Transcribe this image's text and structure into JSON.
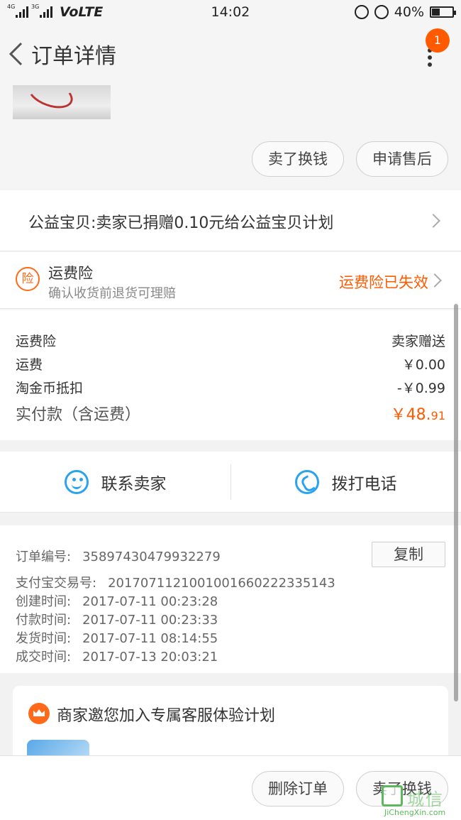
{
  "status_bar": {
    "network_1": "4G",
    "network_2": "3G",
    "volte": "VoLTE",
    "time": "14:02",
    "battery": "40%",
    "battery_level": 0.4
  },
  "nav": {
    "title": "订单详情",
    "badge_count": "1"
  },
  "item_actions": {
    "sell": "卖了换钱",
    "after_sale": "申请售后"
  },
  "charity": {
    "text": "公益宝贝:卖家已捐赠0.10元给公益宝贝计划"
  },
  "insurance": {
    "icon_text": "险",
    "title": "运费险",
    "subtitle": "确认收货前退货可理赔",
    "status": "运费险已失效"
  },
  "fees": {
    "rows": [
      {
        "label": "运费险",
        "value": "卖家赠送"
      },
      {
        "label": "运费",
        "value": "￥0.00"
      },
      {
        "label": "淘金币抵扣",
        "value": "-￥0.99"
      }
    ],
    "total_label": "实付款（含运费）",
    "total_main": "￥48.",
    "total_decimal": "91"
  },
  "contact": {
    "seller": "联系卖家",
    "phone": "拨打电话"
  },
  "order_info": {
    "copy_label": "复制",
    "rows": [
      {
        "label": "订单编号:",
        "value": "35897430479932279"
      },
      {
        "label": "支付宝交易号:",
        "value": "2017071121001001660222335143"
      },
      {
        "label": "创建时间:",
        "value": "2017-07-11 00:23:28"
      },
      {
        "label": "付款时间:",
        "value": "2017-07-11 00:23:33"
      },
      {
        "label": "发货时间:",
        "value": "2017-07-11 08:14:55"
      },
      {
        "label": "成交时间:",
        "value": "2017-07-13 20:03:21"
      }
    ]
  },
  "service": {
    "title": "商家邀您加入专属客服体验计划"
  },
  "bottom": {
    "delete": "删除订单",
    "sell": "卖了换钱"
  },
  "watermark": {
    "cn": "城信",
    "en": "JiChengXin.com"
  },
  "colors": {
    "accent": "#ff5a00",
    "icon_blue": "#2aa3ef"
  }
}
